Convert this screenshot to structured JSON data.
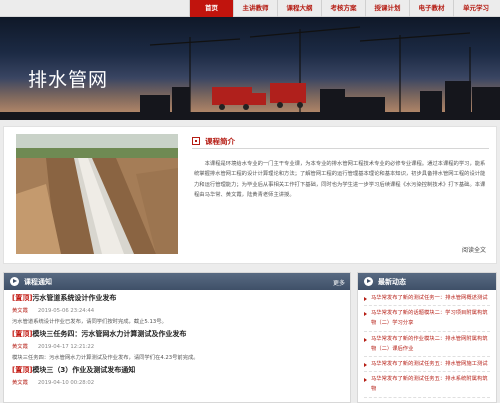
{
  "nav": {
    "tabs": [
      "首页",
      "主讲教师",
      "课程大纲",
      "考核方案",
      "授课计划",
      "电子教材",
      "单元学习"
    ]
  },
  "banner": {
    "title": "排水管网"
  },
  "intro": {
    "heading": "课程简介",
    "description": "本课程是环境给水专业的一门主干专业课，为本专业的排水管网工程技术专业的必修专业课程。通过本课程的学习，能系统掌握排水管网工程的设计计算理论和方法；了解管网工程的运行管理基本理论和基本知识，初步具备排水管网工程的设计能力和运行管理能力；为毕业后从事相关工作打下基础，同时也为学生进一步学习后续课程《水污染控制技术》打下基础。本课程由马华常、黄文霞，陆黄青老师主讲授。",
    "more": "阅读全文"
  },
  "notice": {
    "heading": "课程通知",
    "more": "更多",
    "items": [
      {
        "tag": "[置顶]",
        "title": "污水管道系统设计作业发布",
        "author": "黄文霞",
        "time": "2019-05-06 23:24:44",
        "summary": "污水管道系统设计作业已发布，请同学们按时完成，截止5.13号。"
      },
      {
        "tag": "[置顶]",
        "title": "模块三任务四：污水管网水力计算测试及作业发布",
        "author": "黄文霞",
        "time": "2019-04-17 12:21:22",
        "summary": "模块三任务四：污水管网水力计算测试及作业发布，请同学们在4.23号前完成。"
      },
      {
        "tag": "[置顶]",
        "title": "模块三（3）作业及测试发布通知",
        "author": "黄文霞",
        "time": "2019-04-10 00:28:02",
        "summary": ""
      }
    ]
  },
  "dynamics": {
    "heading": "最新动态",
    "items": [
      "马华常发布了新的测试任务一：排水管网概述测试",
      "马华常发布了新的话题模块二：学习项目附属构筑物（二）学习分享",
      "马华常发布了新的作业模块二：排水管网附属构筑物（二）课后作业",
      "马华常发布了新的测试任务五：排水管网施工测试",
      "马华常发布了新的测试任务五：排水系统附属构筑物"
    ]
  }
}
